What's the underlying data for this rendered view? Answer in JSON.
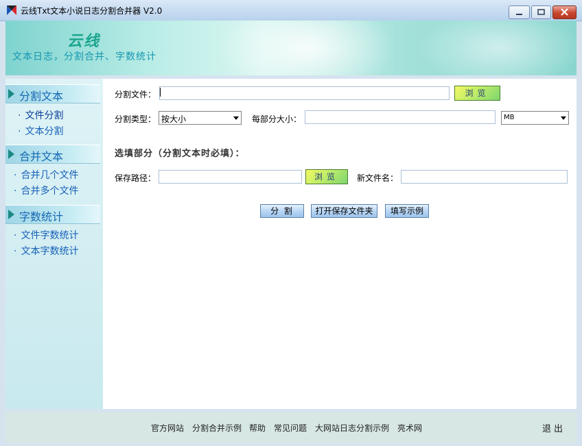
{
  "window": {
    "title": "云线Txt文本小说日志分割合并器 V2.0"
  },
  "banner": {
    "logo": "云线",
    "subtitle": "文本日志，分割合并、字数统计"
  },
  "sidebar": {
    "sections": [
      {
        "title": "分割文本",
        "items": [
          "文件分割",
          "文本分割"
        ]
      },
      {
        "title": "合并文本",
        "items": [
          "合并几个文件",
          "合并多个文件"
        ]
      },
      {
        "title": "字数统计",
        "items": [
          "文件字数统计",
          "文本字数统计"
        ]
      }
    ],
    "bullet": "·"
  },
  "form": {
    "file_label": "分割文件：",
    "file_value": "",
    "browse_label": "浏览",
    "type_label": "分割类型：",
    "type_value": "按大小",
    "size_label": "每部分大小：",
    "size_value": "",
    "unit_value": "MB",
    "optional_title": "选填部分（分割文本时必填）：",
    "save_label": "保存路径：",
    "save_value": "",
    "browse2_label": "浏览",
    "newname_label": "新文件名：",
    "newname_value": ""
  },
  "actions": {
    "split": "分 割",
    "open_folder": "打开保存文件夹",
    "example": "填写示例"
  },
  "footer": {
    "links": [
      "官方网站",
      "分割合并示例",
      "帮助",
      "常见问题",
      "大网站日志分割示例",
      "亮术网"
    ],
    "exit": "退出"
  },
  "colors": {
    "accent": "#1568b4",
    "banner": "#a3e1da",
    "browse": "#c7ef68"
  }
}
